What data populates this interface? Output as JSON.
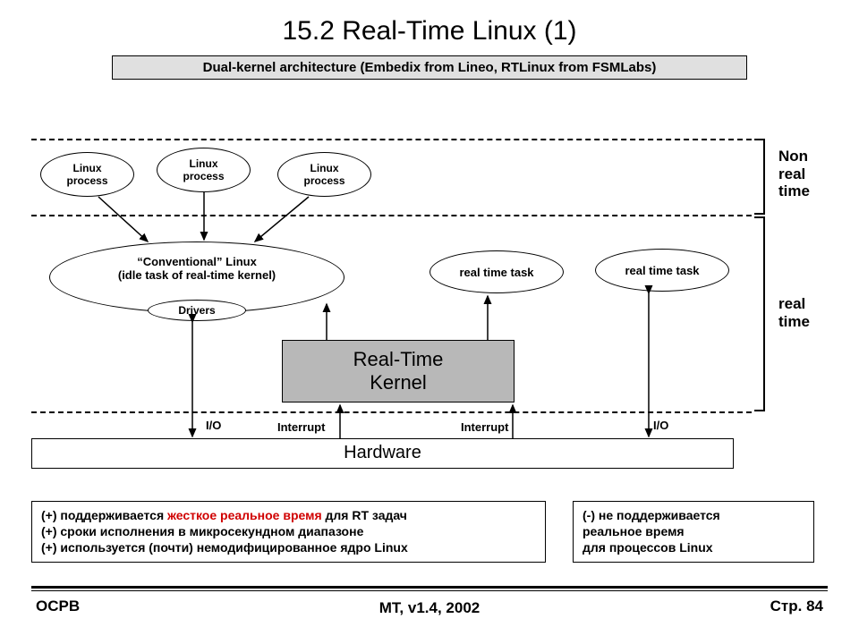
{
  "title": "15.2 Real-Time Linux (1)",
  "subtitle": "Dual-kernel architecture (Embedix from Lineo, RTLinux from FSMLabs)",
  "nodes": {
    "linuxProcess": "Linux\nprocess",
    "convLinux1": "“Conventional” Linux",
    "convLinux2": "(idle task of real-time kernel)",
    "drivers": "Drivers",
    "rtTask": "real time task",
    "rtKernel1": "Real-Time",
    "rtKernel2": "Kernel",
    "hardware": "Hardware"
  },
  "zones": {
    "nonRT": "Non\nreal\ntime",
    "RT": "real\ntime"
  },
  "arrowLabels": {
    "io": "I/O",
    "interrupt": "Interrupt"
  },
  "pros": {
    "l1a": "(+) поддерживается ",
    "l1b": "жесткое реальное время",
    "l1c": " для RT задач",
    "l2": "(+) сроки исполнения в микросекундном диапазоне",
    "l3": "(+) используется (почти) немодифицированное ядро Linux"
  },
  "cons": {
    "l1": "(-) не поддерживается",
    "l2": "реальное время",
    "l3": "для процессов Linux"
  },
  "footer": {
    "left": "ОСРВ",
    "center": "MT, v1.4, 2002",
    "right": "Стр. 84"
  }
}
